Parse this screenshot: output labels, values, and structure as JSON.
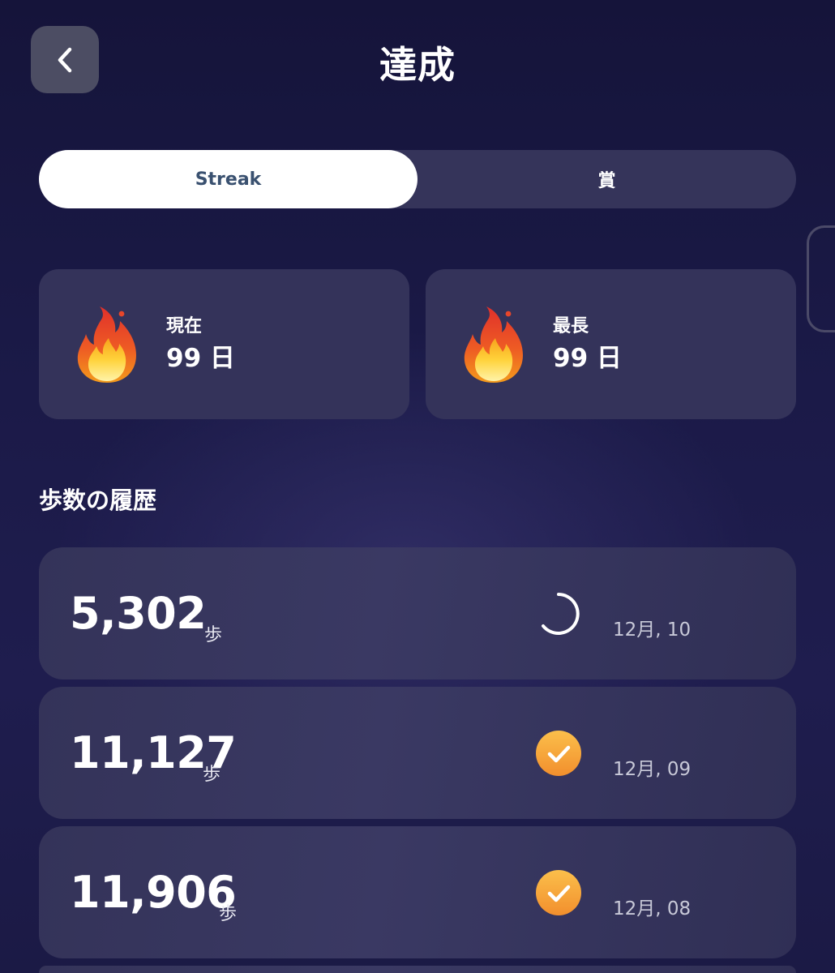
{
  "header": {
    "title": "達成"
  },
  "tabs": [
    {
      "label": "Streak",
      "active": true
    },
    {
      "label": "賞",
      "active": false
    }
  ],
  "streak": {
    "current": {
      "label": "現在",
      "value": "99 日"
    },
    "longest": {
      "label": "最長",
      "value": "99 日"
    }
  },
  "history": {
    "title": "歩数の履歴",
    "unit": "歩",
    "rows": [
      {
        "steps": "5,302",
        "date": "12月, 10",
        "status": "in-progress"
      },
      {
        "steps": "11,127",
        "date": "12月, 09",
        "status": "complete"
      },
      {
        "steps": "11,906",
        "date": "12月, 08",
        "status": "complete"
      }
    ]
  },
  "colors": {
    "background": "#1b1a48",
    "card": "#34335a",
    "active_tab_bg": "#ffffff",
    "active_tab_text": "#3a5170",
    "check_badge": "#f7a93c"
  },
  "icons": {
    "back": "chevron-left-icon",
    "streak": "flame-icon",
    "in_progress": "progress-ring-icon",
    "complete": "check-circle-icon"
  }
}
